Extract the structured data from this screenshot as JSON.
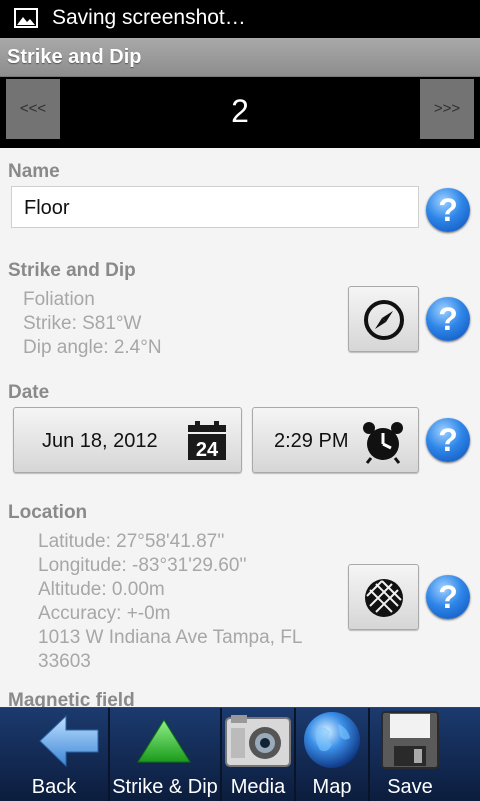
{
  "status_bar": {
    "text": "Saving screenshot…",
    "icon": "image-icon"
  },
  "title_bar": {
    "title": "Strike and Dip"
  },
  "pager": {
    "prev_label": "<<<",
    "next_label": ">>>",
    "page": "2"
  },
  "name_section": {
    "label": "Name",
    "value": "Floor"
  },
  "strike_section": {
    "label": "Strike and Dip",
    "lines": [
      "Foliation",
      "Strike: S81°W",
      "Dip angle: 2.4°N"
    ],
    "button_icon": "compass-icon"
  },
  "date_section": {
    "label": "Date",
    "date_value": "Jun 18, 2012",
    "date_icon_text": "24",
    "time_value": "2:29 PM"
  },
  "location_section": {
    "label": "Location",
    "lines": [
      "Latitude: 27°58'41.87''",
      "Longitude: -83°31'29.60''",
      "Altitude: 0.00m",
      "Accuracy: +-0m",
      "1013 W Indiana Ave Tampa, FL",
      "33603"
    ],
    "button_icon": "globe-grid-icon"
  },
  "partial_section": {
    "label": "Magnetic field"
  },
  "help_label": "?",
  "bottom_bar": {
    "items": [
      {
        "label": "Back",
        "icon": "back-arrow-icon"
      },
      {
        "label": "Strike & Dip",
        "icon": "triangle-icon"
      },
      {
        "label": "Media",
        "icon": "camera-icon"
      },
      {
        "label": "Map",
        "icon": "globe-icon"
      },
      {
        "label": "Save",
        "icon": "floppy-disk-icon"
      }
    ]
  },
  "colors": {
    "accent": "#2f86e8",
    "bottom_bar": "#12284f",
    "section_label": "#8a8a8a",
    "info_text": "#a7a7a7"
  }
}
